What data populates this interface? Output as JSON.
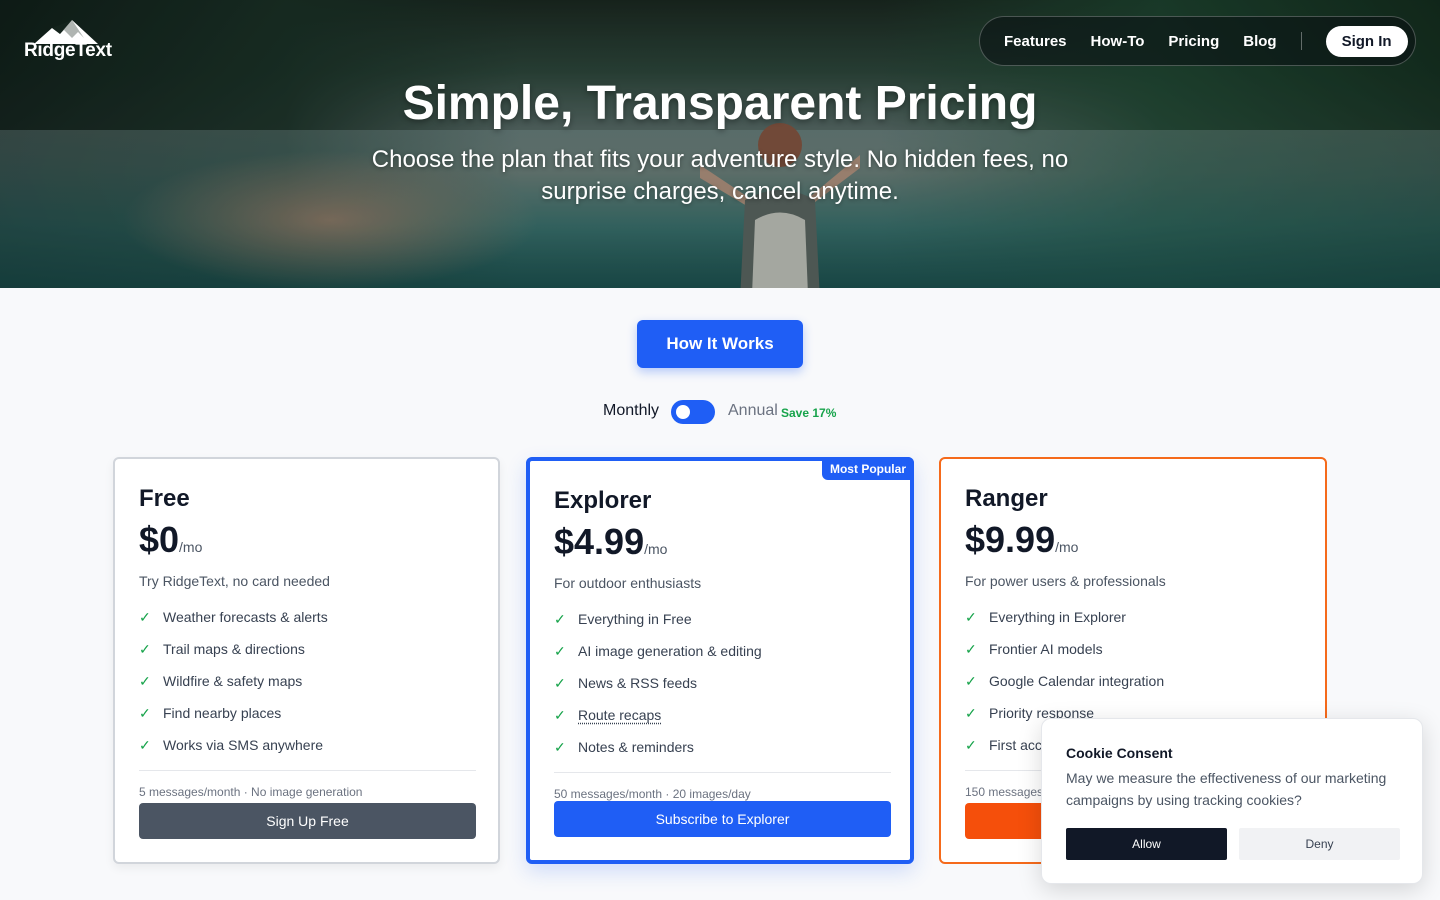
{
  "brand": {
    "name": "RidgeText",
    "logo_icon": "mountain-icon"
  },
  "nav": {
    "items": [
      "Features",
      "How-To",
      "Pricing",
      "Blog"
    ],
    "signin_label": "Sign In"
  },
  "hero": {
    "title": "Simple, Transparent Pricing",
    "subtitle": "Choose the plan that fits your adventure style. No hidden fees, no surprise charges, cancel anytime."
  },
  "how_it_works_label": "How It Works",
  "billing": {
    "monthly_label": "Monthly",
    "annual_label": "Annual",
    "save_label": "Save 17%",
    "annual_selected": false
  },
  "plans": [
    {
      "name": "Free",
      "price": "$0",
      "period": "/mo",
      "description": "Try RidgeText, no card needed",
      "features": [
        "Weather forecasts & alerts",
        "Trail maps & directions",
        "Wildfire & safety maps",
        "Find nearby places",
        "Works via SMS anywhere"
      ],
      "limits": "5 messages/month · No image generation",
      "cta": "Sign Up Free"
    },
    {
      "name": "Explorer",
      "price": "$4.99",
      "period": "/mo",
      "badge": "Most Popular",
      "description": "For outdoor enthusiasts",
      "features": [
        "Everything in Free",
        "AI image generation & editing",
        "News & RSS feeds",
        "Route recaps",
        "Notes & reminders"
      ],
      "limits": "50 messages/month · 20 images/day",
      "cta": "Subscribe to Explorer"
    },
    {
      "name": "Ranger",
      "price": "$9.99",
      "period": "/mo",
      "description": "For power users & professionals",
      "features": [
        "Everything in Explorer",
        "Frontier AI models",
        "Google Calendar integration",
        "Priority response",
        "First acc"
      ],
      "limits": "150 messages",
      "cta": ""
    }
  ],
  "cookie": {
    "title": "Cookie Consent",
    "text": "May we measure the effectiveness of our marketing campaigns by using tracking cookies?",
    "allow_label": "Allow",
    "deny_label": "Deny"
  },
  "colors": {
    "primary": "#1f5ef5",
    "ranger": "#f54f0b",
    "success": "#16a34a",
    "dark": "#111827"
  }
}
